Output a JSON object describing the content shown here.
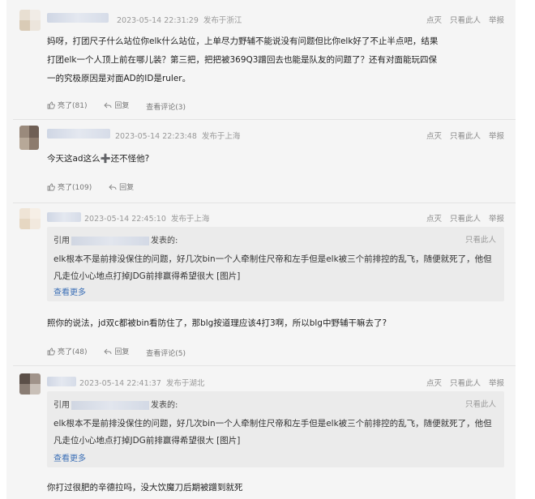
{
  "common": {
    "ops": [
      "点灭",
      "只看此人",
      "举报"
    ],
    "like_icon": "thumbs-up-icon",
    "reply_icon": "reply-icon"
  },
  "posts": [
    {
      "date": "2023-05-14 22:31:29",
      "location": "发布于浙江",
      "text": "妈呀，打团尺子什么站位你elk什么站位，上单尽力野辅不能说没有问题但比你elk好了不止半点吧，结果打团elk一个人顶上前在哪儿装？第三把，把把被369Q3蹭回去也能是队友的问题了？还有对面能玩四保一的究极原因是对面AD的ID是ruler。",
      "like": "亮了(81)",
      "reply": "回复",
      "view": "查看评论(3)"
    },
    {
      "date": "2023-05-14 22:23:48",
      "location": "发布于上海",
      "text": "今天这ad这么➕还不怪他?",
      "like": "亮了(109)",
      "reply": "回复"
    },
    {
      "date": "2023-05-14 22:45:10",
      "location": "发布于上海",
      "quote_prefix": "引用",
      "quote_suffix": "发表的:",
      "quote_only": "只看此人",
      "quote_text": "elk根本不是前排没保住的问题，好几次bin一个人牵制住尺帝和左手但是elk被三个前排控的乱飞，随便就死了，他但凡走位小心地点打掉JDG前排赢得希望很大 [图片]",
      "quote_more": "查看更多",
      "text": "照你的说法，jd双c都被bin看防住了，那blg按道理应该4打3啊，所以blg中野辅干嘛去了?",
      "like": "亮了(48)",
      "reply": "回复",
      "view": "查看评论(5)"
    },
    {
      "date": "2023-05-14 22:41:37",
      "location": "发布于湖北",
      "quote_prefix": "引用",
      "quote_suffix": "发表的:",
      "quote_only": "只看此人",
      "quote_text": "elk根本不是前排没保住的问题，好几次bin一个人牵制住尺帝和左手但是elk被三个前排控的乱飞，随便就死了，他但凡走位小心地点打掉JDG前排赢得希望很大 [图片]",
      "quote_more": "查看更多",
      "text": "你打过很肥的辛德拉吗，没大饮魔刀后期被蹭到就死"
    }
  ]
}
